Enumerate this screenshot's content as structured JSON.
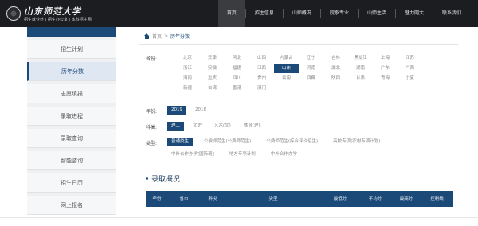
{
  "header": {
    "logo_name": "山东师范大学",
    "logo_sub": "招生就业处 | 招生办公室 | 本科招生网",
    "nav": [
      "首页",
      "招生信息",
      "山师概况",
      "院系专业",
      "山师生活",
      "魅力网大",
      "联系我们"
    ],
    "active_index": 0
  },
  "sidebar": {
    "items": [
      "招生计划",
      "历年分数",
      "志愿填报",
      "录取进程",
      "录取查询",
      "智能咨询",
      "招生日历",
      "网上报名"
    ],
    "active_index": 1
  },
  "breadcrumb": {
    "home": "首页",
    "separator": ">",
    "current": "历年分数"
  },
  "filters": {
    "province_label": "省份:",
    "provinces": [
      "北京",
      "天津",
      "河北",
      "山西",
      "内蒙古",
      "辽宁",
      "吉林",
      "黑龙江",
      "上海",
      "江苏",
      "浙江",
      "安徽",
      "福建",
      "江西",
      "山东",
      "河南",
      "湖北",
      "湖南",
      "广东",
      "广西",
      "海南",
      "重庆",
      "四川",
      "贵州",
      "云南",
      "西藏",
      "陕西",
      "甘肃",
      "青海",
      "宁夏",
      "新疆",
      "台湾",
      "香港",
      "澳门"
    ],
    "province_active": "山东",
    "year_label": "年份:",
    "years": [
      "2019",
      "2018"
    ],
    "year_active": "2019",
    "subject_label": "科类:",
    "subjects": [
      "理工",
      "文史",
      "艺术(文)",
      "体育(理)"
    ],
    "subject_active": "理工",
    "type_label": "类型:",
    "types": [
      "普通类生",
      "公费师范生(公费师范生)",
      "公费师范生(综合评价招生)",
      "高校专项(农村专项计划)",
      "中外合作办学(国际班)",
      "地方专项计划",
      "中外合作办学"
    ],
    "type_active": "普通类生"
  },
  "section": {
    "title": "录取概况"
  },
  "table": {
    "columns": [
      "年份",
      "省市",
      "科类",
      "类型",
      "最低分",
      "平均分",
      "最高分",
      "控制线"
    ]
  },
  "colors": {
    "primary": "#1b4a78",
    "topbar": "#1b1d21"
  }
}
